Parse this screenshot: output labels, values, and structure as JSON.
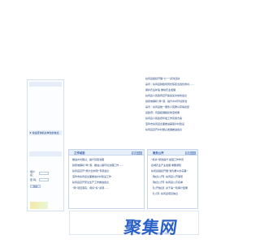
{
  "left_panel": {
    "quick_link": "★ 快速查询机关单位的信息",
    "login": {
      "user_label": "用户名：",
      "pass_label": "密 码：",
      "button": "登录"
    }
  },
  "right_list": [
    "扶风县组织开展“七一”系列活动",
    "喜讯｜扶风县财政局局长陈民当选优秀共……",
    "保护农业补贴 推动农业发展",
    "扶风县人民政府召开第某某次常务会议",
    "铁家坡镇机“两”落，提升乡村环境整治",
    "喜讯｜扶风县统一服务人民群众获得表彰",
    "县政府：巩固拓展脱贫攻坚成果",
    "扶风县人民政府印发工作实施方案",
    "宝鸡市扶风县全面推进美丽乡村建设",
    "扶风县召开乡村振兴发展推进会议"
  ],
  "col1": {
    "title": "工作动态",
    "more": "更多>>",
    "items": [
      "推进乡村振兴，提升基层治理",
      "铁家坡镇机“两”落，推进公路环境治理工作……",
      "扶风县召开“两大创文明”专项会议",
      "宝鸡市扶风县全面推进乡村建设工作",
      "扶风县召开安全生产工作推进会议",
      "“两”项目落实，用好“好”资源……"
    ]
  },
  "col2": {
    "title": "政务公开",
    "more": "更多>>",
    "items": [
      "“机关”整改提升 加强工作作风",
      "县域农业产业发展 重要通知",
      "扶风县组织开展“我为群众办实事”",
      "【信息公开】扶风县公开事项",
      "【信息公开】扶风县公示名单",
      "【公开信息】关于第一轮审计结果",
      "【公示】扶风县项目信息"
    ]
  },
  "watermark": {
    "text": "聚集网",
    "sub": "JUJI.NET"
  }
}
